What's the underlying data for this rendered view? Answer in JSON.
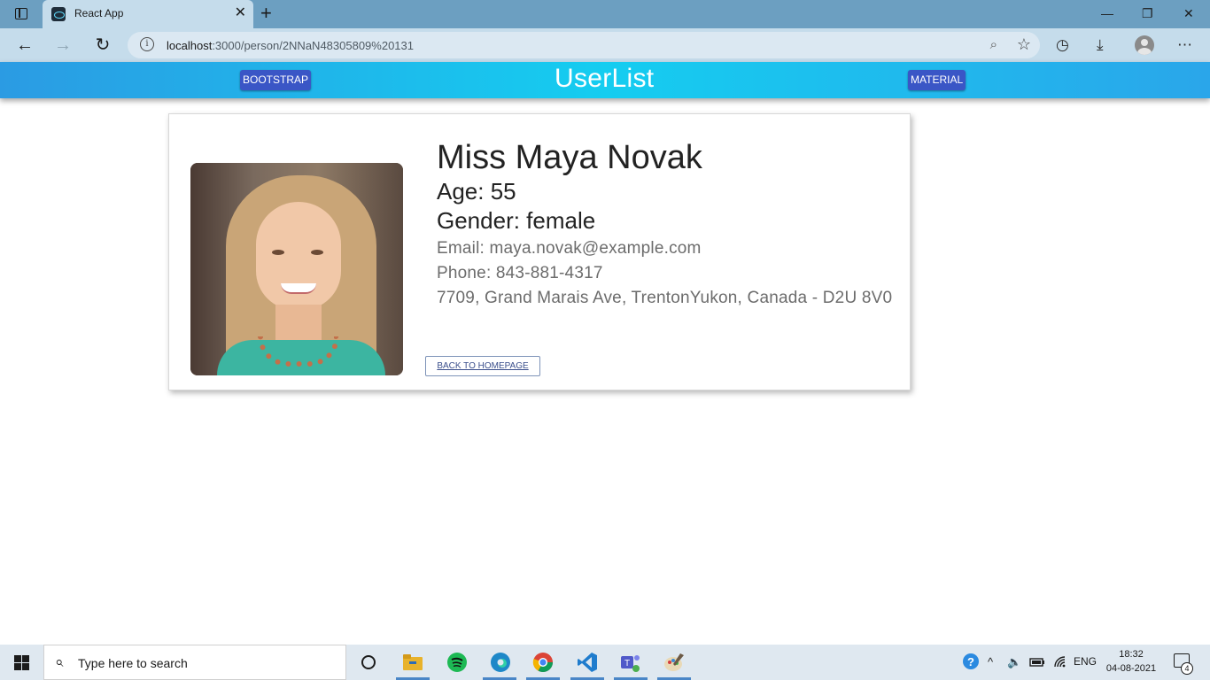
{
  "browser": {
    "tab_title": "React App",
    "tab_close": "✕",
    "new_tab": "+",
    "window_controls": {
      "minimize": "—",
      "restore": "❐",
      "close": "✕"
    },
    "url_host": "localhost",
    "url_path": ":3000/person/2NNaN48305809%20131",
    "nav": {
      "back": "←",
      "forward": "→",
      "reload": "↻"
    }
  },
  "app": {
    "logo": "UserList",
    "left_button": "BOOTSTRAP",
    "right_button": "MATERIAL"
  },
  "person": {
    "name": "Miss Maya Novak",
    "age": "Age: 55",
    "gender": "Gender: female",
    "email": "Email: maya.novak@example.com",
    "phone": "Phone: 843-881-4317",
    "address": "7709, Grand Marais Ave, TrentonYukon, Canada - D2U 8V0",
    "back_button": "BACK TO HOMEPAGE"
  },
  "taskbar": {
    "search_placeholder": "Type here to search",
    "language": "ENG",
    "time": "18:32",
    "date": "04-08-2021",
    "notification_count": "4",
    "apps": [
      "file-explorer-icon",
      "spotify-icon",
      "edge-icon",
      "chrome-icon",
      "vscode-icon",
      "teams-icon",
      "paint-icon"
    ]
  }
}
